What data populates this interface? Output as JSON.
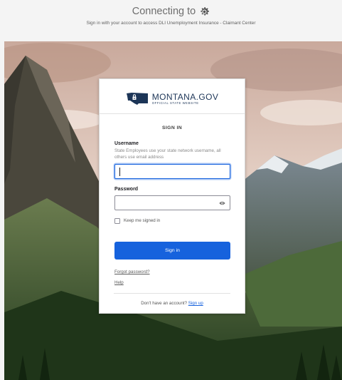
{
  "banner": {
    "connecting_label": "Connecting to",
    "subtitle": "Sign in with your account to access DLI Unemployment Insurance - Claimant Center"
  },
  "logo": {
    "main_text": "MONTANA.GOV",
    "sub_text": "OFFICIAL STATE WEBSITE"
  },
  "form": {
    "title": "SIGN IN",
    "username_label": "Username",
    "username_hint": "State Employees use your state network username, all others use email address",
    "username_value": "",
    "password_label": "Password",
    "password_value": "",
    "keep_signed_in_label": "Keep me signed in",
    "keep_signed_in_checked": false,
    "signin_button": "Sign in",
    "forgot_password_link": "Forgot password?",
    "help_link": "Help",
    "no_account_text": "Don't have an account?",
    "signup_link": "Sign up"
  },
  "icons": {
    "connecting": "gear-icon",
    "password_toggle": "eye-icon",
    "logo": "montana-state-icon"
  },
  "colors": {
    "primary": "#1662dd",
    "logo_navy": "#1c3557",
    "text_dark": "#1d1d21",
    "banner_bg": "#f4f4f4"
  }
}
